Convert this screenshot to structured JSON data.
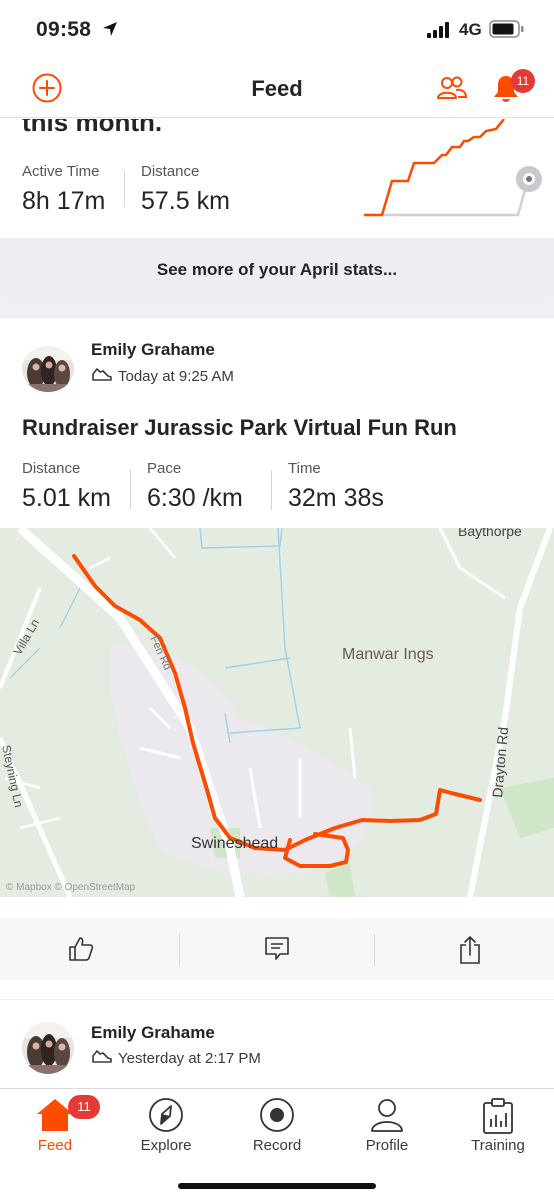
{
  "status_bar": {
    "time": "09:58",
    "network": "4G"
  },
  "header": {
    "title": "Feed",
    "notification_count": "11"
  },
  "month_summary": {
    "heading": "this month.",
    "stats": [
      {
        "label": "Active Time",
        "value": "8h 17m"
      },
      {
        "label": "Distance",
        "value": "57.5 km"
      }
    ],
    "see_more_label": "See more of your April stats..."
  },
  "activity": {
    "athlete": "Emily Grahame",
    "timestamp": "Today at 9:25 AM",
    "title": "Rundraiser Jurassic Park Virtual Fun Run",
    "stats": [
      {
        "label": "Distance",
        "value": "5.01 km"
      },
      {
        "label": "Pace",
        "value": "6:30 /km"
      },
      {
        "label": "Time",
        "value": "32m 38s"
      }
    ],
    "map": {
      "places": [
        "Baythorpe",
        "Manwar Ings",
        "Swineshead",
        "Villa Ln",
        "Steyning Ln",
        "Drayton Rd",
        "Fen Rd"
      ],
      "attribution": "© Mapbox © OpenStreetMap",
      "route_color": "#fc4c02"
    },
    "actions": [
      "thumbs-up-icon",
      "comment-icon",
      "share-icon"
    ]
  },
  "activity2": {
    "athlete": "Emily Grahame",
    "timestamp": "Yesterday at 2:17 PM"
  },
  "tabbar": {
    "tabs": [
      {
        "label": "Feed",
        "icon": "home-icon",
        "active": true,
        "badge": "11"
      },
      {
        "label": "Explore",
        "icon": "compass-icon"
      },
      {
        "label": "Record",
        "icon": "record-icon"
      },
      {
        "label": "Profile",
        "icon": "profile-icon"
      },
      {
        "label": "Training",
        "icon": "training-icon"
      }
    ]
  },
  "colors": {
    "brand": "#fc4c02",
    "badge": "#e53935"
  }
}
